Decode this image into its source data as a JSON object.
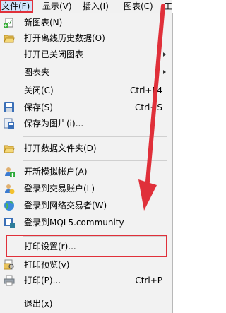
{
  "menubar": {
    "items": [
      "文件(F)",
      "显示(V)",
      "插入(I)",
      "图表(C)",
      "工"
    ]
  },
  "menu": {
    "new_chart": "新图表(N)",
    "open_offline": "打开离线历史数据(O)",
    "open_closed": "打开已关闭图表",
    "chart_folder": "图表夹",
    "close": "关闭(C)",
    "close_shortcut": "Ctrl+F4",
    "save": "保存(S)",
    "save_shortcut": "Ctrl+S",
    "save_as_image": "保存为图片(i)...",
    "open_data_folder": "打开数据文件夹(D)",
    "open_demo": "开新模拟帐户(A)",
    "login_trade": "登录到交易账户(L)",
    "login_web": "登录到网络交易者(W)",
    "login_mql5": "登录到MQL5.community",
    "print_setup": "打印设置(r)...",
    "print_preview": "打印预览(v)",
    "print": "打印(P)...",
    "print_shortcut": "Ctrl+P",
    "exit": "退出(x)"
  },
  "colors": {
    "annotation": "#e0303a",
    "active_menu": "#cfe4fb"
  }
}
